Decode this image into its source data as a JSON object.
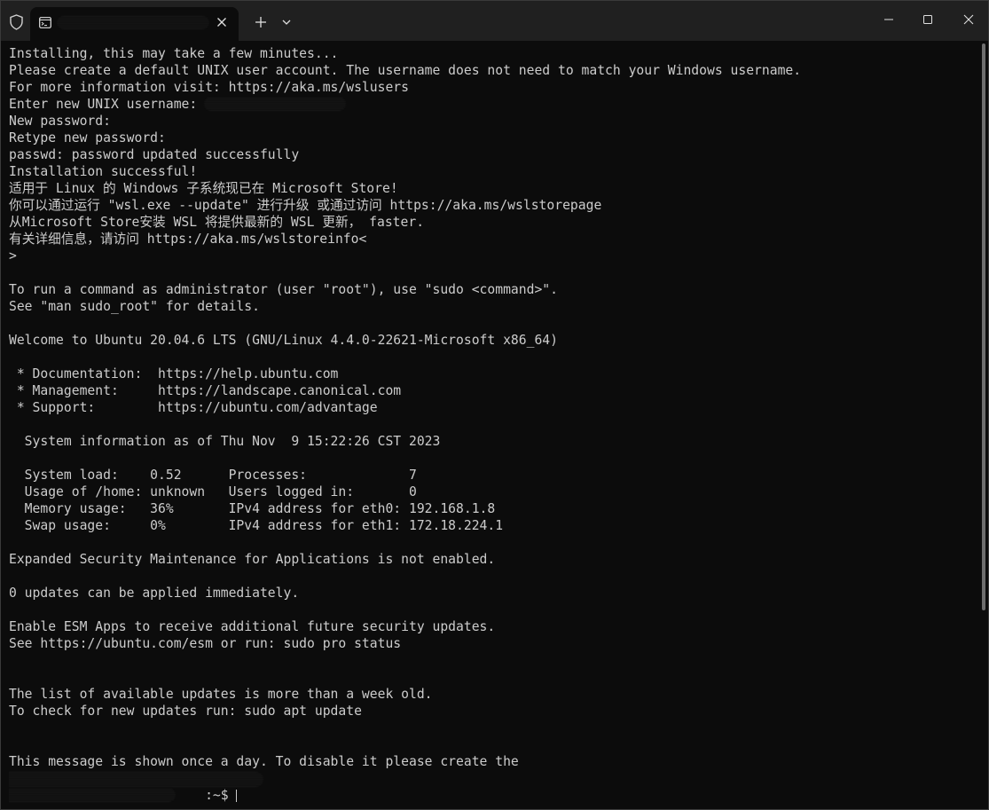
{
  "window": {
    "tab_title": "",
    "controls": {
      "minimize": "minimize",
      "maximize": "maximize",
      "close": "close"
    },
    "icons": {
      "shield": "shield-icon",
      "tab": "terminal-tab-icon",
      "tab_close": "close-icon",
      "new_tab": "plus-icon",
      "dropdown": "chevron-down-icon"
    }
  },
  "terminal": {
    "lines": [
      "Installing, this may take a few minutes...",
      "Please create a default UNIX user account. The username does not need to match your Windows username.",
      "For more information visit: https://aka.ms/wslusers",
      "Enter new UNIX username: ",
      "New password:",
      "Retype new password:",
      "passwd: password updated successfully",
      "Installation successful!",
      "适用于 Linux 的 Windows 子系统现已在 Microsoft Store!",
      "你可以通过运行 \"wsl.exe --update\" 进行升级 或通过访问 https://aka.ms/wslstorepage",
      "从Microsoft Store安装 WSL 将提供最新的 WSL 更新， faster.",
      "有关详细信息，请访问 https://aka.ms/wslstoreinfo<",
      ">",
      "",
      "To run a command as administrator (user \"root\"), use \"sudo <command>\".",
      "See \"man sudo_root\" for details.",
      "",
      "Welcome to Ubuntu 20.04.6 LTS (GNU/Linux 4.4.0-22621-Microsoft x86_64)",
      "",
      " * Documentation:  https://help.ubuntu.com",
      " * Management:     https://landscape.canonical.com",
      " * Support:        https://ubuntu.com/advantage",
      "",
      "  System information as of Thu Nov  9 15:22:26 CST 2023",
      "",
      "  System load:    0.52      Processes:             7",
      "  Usage of /home: unknown   Users logged in:       0",
      "  Memory usage:   36%       IPv4 address for eth0: 192.168.1.8",
      "  Swap usage:     0%        IPv4 address for eth1: 172.18.224.1",
      "",
      "Expanded Security Maintenance for Applications is not enabled.",
      "",
      "0 updates can be applied immediately.",
      "",
      "Enable ESM Apps to receive additional future security updates.",
      "See https://ubuntu.com/esm or run: sudo pro status",
      "",
      "",
      "The list of available updates is more than a week old.",
      "To check for new updates run: sudo apt update",
      "",
      "",
      "This message is shown once a day. To disable it please create the"
    ],
    "prompt_suffix": ":~$ "
  }
}
